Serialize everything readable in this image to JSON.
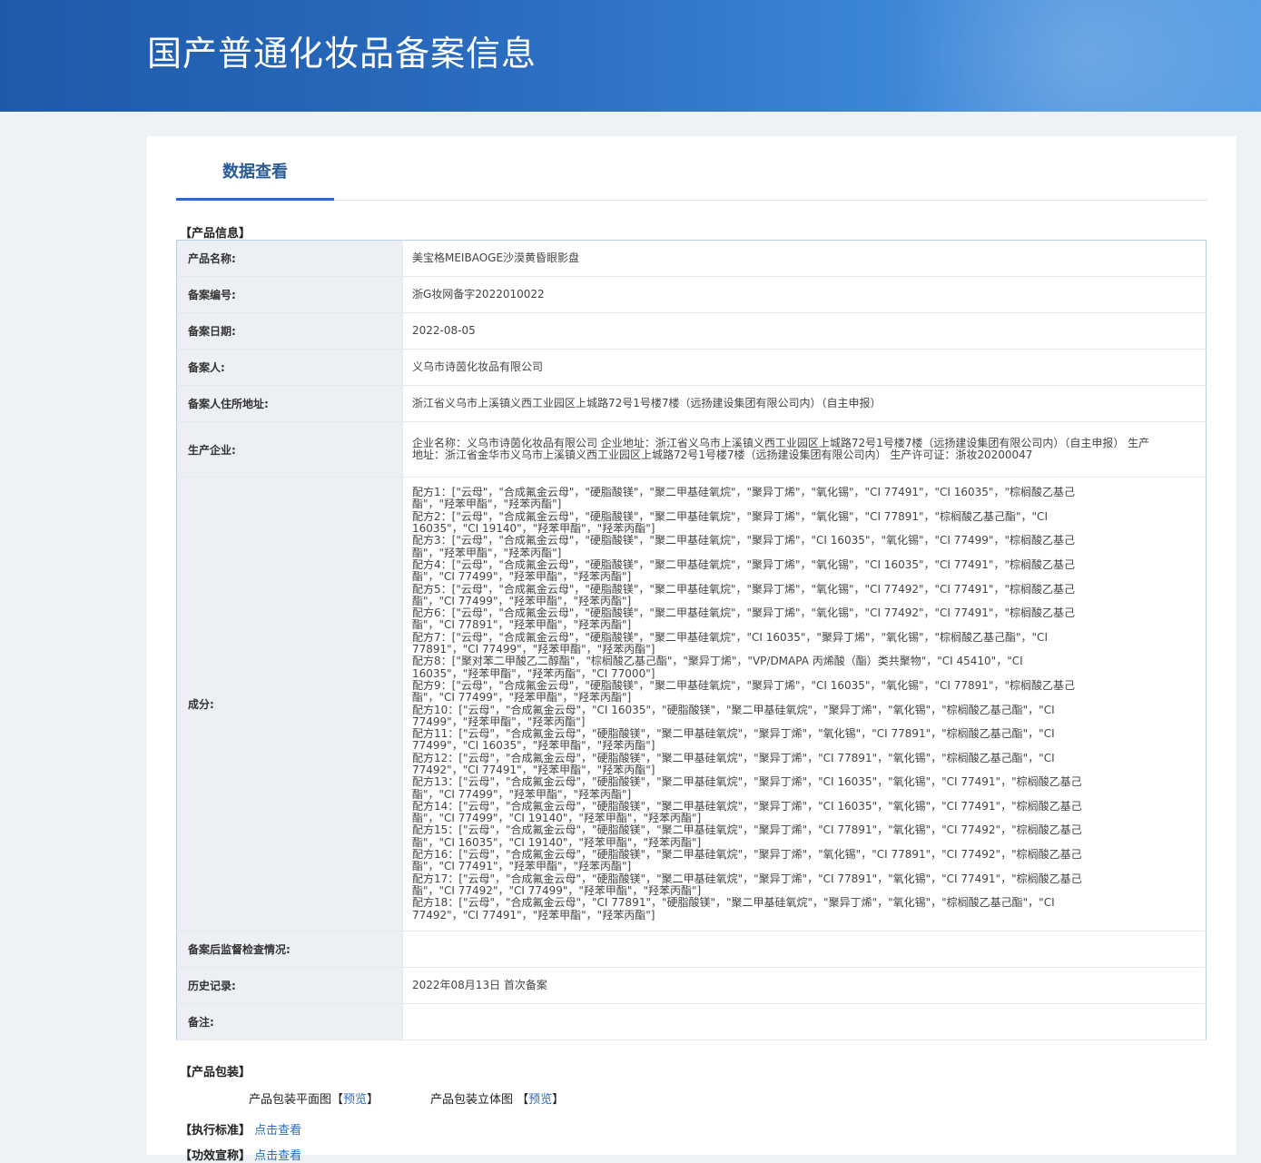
{
  "header": {
    "title": "国产普通化妆品备案信息"
  },
  "tab": {
    "label": "数据查看"
  },
  "sections": {
    "product_info": "【产品信息】",
    "packaging": "【产品包装】",
    "standard": "【执行标准】",
    "efficacy": "【功效宣称】"
  },
  "fields": {
    "product_name": {
      "label": "产品名称:",
      "value": "美宝格MEIBAOGE沙漠黄昏眼影盘"
    },
    "record_no": {
      "label": "备案编号:",
      "value": "浙G妆网备字2022010022"
    },
    "record_date": {
      "label": "备案日期:",
      "value": "2022-08-05"
    },
    "registrant": {
      "label": "备案人:",
      "value": "义乌市诗茵化妆品有限公司"
    },
    "address": {
      "label": "备案人住所地址:",
      "value": "浙江省义乌市上溪镇义西工业园区上城路72号1号楼7楼（远扬建设集团有限公司内）（自主申报）"
    },
    "manufacturer": {
      "label": "生产企业:",
      "value": "企业名称：义乌市诗茵化妆品有限公司 企业地址：浙江省义乌市上溪镇义西工业园区上城路72号1号楼7楼（远扬建设集团有限公司内）（自主申报） 生产地址：浙江省金华市义乌市上溪镇义西工业园区上城路72号1号楼7楼（远扬建设集团有限公司内） 生产许可证：浙妆20200047"
    },
    "ingredients": {
      "label": "成分:",
      "lines": [
        "配方1：[\"云母\"，\"合成氟金云母\"，\"硬脂酸镁\"，\"聚二甲基硅氧烷\"，\"聚异丁烯\"，\"氧化锡\"，\"CI 77491\"，\"CI 16035\"，\"棕榈酸乙基己",
        "酯\"，\"羟苯甲酯\"，\"羟苯丙酯\"]",
        "配方2：[\"云母\"，\"合成氟金云母\"，\"硬脂酸镁\"，\"聚二甲基硅氧烷\"，\"聚异丁烯\"，\"氧化锡\"，\"CI 77891\"，\"棕榈酸乙基己酯\"，\"CI",
        "16035\"，\"CI 19140\"，\"羟苯甲酯\"，\"羟苯丙酯\"]",
        "配方3：[\"云母\"，\"合成氟金云母\"，\"硬脂酸镁\"，\"聚二甲基硅氧烷\"，\"聚异丁烯\"，\"CI 16035\"，\"氧化锡\"，\"CI 77499\"，\"棕榈酸乙基己",
        "酯\"，\"羟苯甲酯\"，\"羟苯丙酯\"]",
        "配方4：[\"云母\"，\"合成氟金云母\"，\"硬脂酸镁\"，\"聚二甲基硅氧烷\"，\"聚异丁烯\"，\"氧化锡\"，\"CI 16035\"，\"CI 77491\"，\"棕榈酸乙基己",
        "酯\"，\"CI 77499\"，\"羟苯甲酯\"，\"羟苯丙酯\"]",
        "配方5：[\"云母\"，\"合成氟金云母\"，\"硬脂酸镁\"，\"聚二甲基硅氧烷\"，\"聚异丁烯\"，\"氧化锡\"，\"CI 77492\"，\"CI 77491\"，\"棕榈酸乙基己",
        "酯\"，\"CI 77499\"，\"羟苯甲酯\"，\"羟苯丙酯\"]",
        "配方6：[\"云母\"，\"合成氟金云母\"，\"硬脂酸镁\"，\"聚二甲基硅氧烷\"，\"聚异丁烯\"，\"氧化锡\"，\"CI 77492\"，\"CI 77491\"，\"棕榈酸乙基己",
        "酯\"，\"CI 77891\"，\"羟苯甲酯\"，\"羟苯丙酯\"]",
        "配方7：[\"云母\"，\"合成氟金云母\"，\"硬脂酸镁\"，\"聚二甲基硅氧烷\"，\"CI 16035\"，\"聚异丁烯\"，\"氧化锡\"，\"棕榈酸乙基己酯\"，\"CI",
        "77891\"，\"CI 77499\"，\"羟苯甲酯\"，\"羟苯丙酯\"]",
        "配方8：[\"聚对苯二甲酸乙二醇酯\"，\"棕榈酸乙基己酯\"，\"聚异丁烯\"，\"VP/DMAPA 丙烯酸（酯）类共聚物\"，\"CI 45410\"，\"CI",
        "16035\"，\"羟苯甲酯\"，\"羟苯丙酯\"，\"CI 77000\"]",
        "配方9：[\"云母\"，\"合成氟金云母\"，\"硬脂酸镁\"，\"聚二甲基硅氧烷\"，\"聚异丁烯\"，\"CI 16035\"，\"氧化锡\"，\"CI 77891\"，\"棕榈酸乙基己",
        "酯\"，\"CI 77499\"，\"羟苯甲酯\"，\"羟苯丙酯\"]",
        "配方10：[\"云母\"，\"合成氟金云母\"，\"CI 16035\"，\"硬脂酸镁\"，\"聚二甲基硅氧烷\"，\"聚异丁烯\"，\"氧化锡\"，\"棕榈酸乙基己酯\"，\"CI",
        "77499\"，\"羟苯甲酯\"，\"羟苯丙酯\"]",
        "配方11：[\"云母\"，\"合成氟金云母\"，\"硬脂酸镁\"，\"聚二甲基硅氧烷\"，\"聚异丁烯\"，\"氧化锡\"，\"CI 77891\"，\"棕榈酸乙基己酯\"，\"CI",
        "77499\"，\"CI 16035\"，\"羟苯甲酯\"，\"羟苯丙酯\"]",
        "配方12：[\"云母\"，\"合成氟金云母\"，\"硬脂酸镁\"，\"聚二甲基硅氧烷\"，\"聚异丁烯\"，\"CI 77891\"，\"氧化锡\"，\"棕榈酸乙基己酯\"，\"CI",
        "77492\"，\"CI 77491\"，\"羟苯甲酯\"，\"羟苯丙酯\"]",
        "配方13：[\"云母\"，\"合成氟金云母\"，\"硬脂酸镁\"，\"聚二甲基硅氧烷\"，\"聚异丁烯\"，\"CI 16035\"，\"氧化锡\"，\"CI 77491\"，\"棕榈酸乙基己",
        "酯\"，\"CI 77499\"，\"羟苯甲酯\"，\"羟苯丙酯\"]",
        "配方14：[\"云母\"，\"合成氟金云母\"，\"硬脂酸镁\"，\"聚二甲基硅氧烷\"，\"聚异丁烯\"，\"CI 16035\"，\"氧化锡\"，\"CI 77491\"，\"棕榈酸乙基己",
        "酯\"，\"CI 77499\"，\"CI 19140\"，\"羟苯甲酯\"，\"羟苯丙酯\"]",
        "配方15：[\"云母\"，\"合成氟金云母\"，\"硬脂酸镁\"，\"聚二甲基硅氧烷\"，\"聚异丁烯\"，\"CI 77891\"，\"氧化锡\"，\"CI 77492\"，\"棕榈酸乙基己",
        "酯\"，\"CI 16035\"，\"CI 19140\"，\"羟苯甲酯\"，\"羟苯丙酯\"]",
        "配方16：[\"云母\"，\"合成氟金云母\"，\"硬脂酸镁\"，\"聚二甲基硅氧烷\"，\"聚异丁烯\"，\"氧化锡\"，\"CI 77891\"，\"CI 77492\"，\"棕榈酸乙基己",
        "酯\"，\"CI 77491\"，\"羟苯甲酯\"，\"羟苯丙酯\"]",
        "配方17：[\"云母\"，\"合成氟金云母\"，\"硬脂酸镁\"，\"聚二甲基硅氧烷\"，\"聚异丁烯\"，\"CI 77891\"，\"氧化锡\"，\"CI 77491\"，\"棕榈酸乙基己",
        "酯\"，\"CI 77492\"，\"CI 77499\"，\"羟苯甲酯\"，\"羟苯丙酯\"]",
        "配方18：[\"云母\"，\"合成氟金云母\"，\"CI 77891\"，\"硬脂酸镁\"，\"聚二甲基硅氧烷\"，\"聚异丁烯\"，\"氧化锡\"，\"棕榈酸乙基己酯\"，\"CI",
        "77492\"，\"CI 77491\"，\"羟苯甲酯\"，\"羟苯丙酯\"]"
      ]
    },
    "inspection": {
      "label": "备案后监督检查情况:",
      "value": ""
    },
    "history": {
      "label": "历史记录:",
      "value": "2022年08月13日 首次备案"
    },
    "remark": {
      "label": "备注:",
      "value": ""
    }
  },
  "packaging": {
    "flat_label": "产品包装平面图",
    "flat_open": "【",
    "flat_link": "预览",
    "flat_close": "】",
    "three_d_label": "产品包装立体图",
    "three_d_open": "【",
    "three_d_link": "预览",
    "three_d_close": "】"
  },
  "links": {
    "standard": "点击查看",
    "efficacy": "点击查看"
  }
}
